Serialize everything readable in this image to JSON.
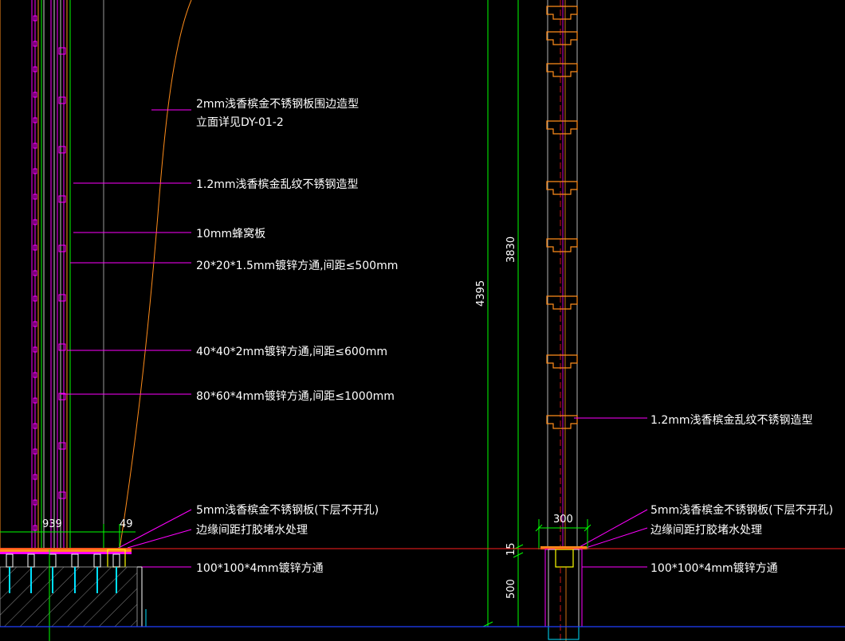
{
  "annotations": {
    "a1": "2mm浅香槟金不锈钢板围边造型",
    "a2": "立面详见DY-01-2",
    "a3": "1.2mm浅香槟金乱纹不锈钢造型",
    "a4": "10mm蜂窝板",
    "a5": "20*20*1.5mm镀锌方通,间距≤500mm",
    "a6": "40*40*2mm镀锌方通,间距≤600mm",
    "a7": "80*60*4mm镀锌方通,间距≤1000mm",
    "a8": "5mm浅香槟金不锈钢板(下层不开孔)",
    "a9": "边缘间距打胶堵水处理",
    "a10": "100*100*4mm镀锌方通",
    "r1": "1.2mm浅香槟金乱纹不锈钢造型",
    "r2": "5mm浅香槟金不锈钢板(下层不开孔)",
    "r3": "边缘间距打胶堵水处理",
    "r4": "100*100*4mm镀锌方通"
  },
  "dimensions": {
    "d939": "939",
    "d49": "49",
    "d300": "300",
    "d4395": "4395",
    "d3830": "3830",
    "d15": "15",
    "d500": "500"
  },
  "colors": {
    "background": "#000000",
    "leader": "#ff00ff",
    "steel": "#ff8c1a",
    "dimension": "#00ff00",
    "floor_line": "#ff2020",
    "ground_line": "#2040ff",
    "insulation": "#00e0ff",
    "concrete": "#888888"
  }
}
